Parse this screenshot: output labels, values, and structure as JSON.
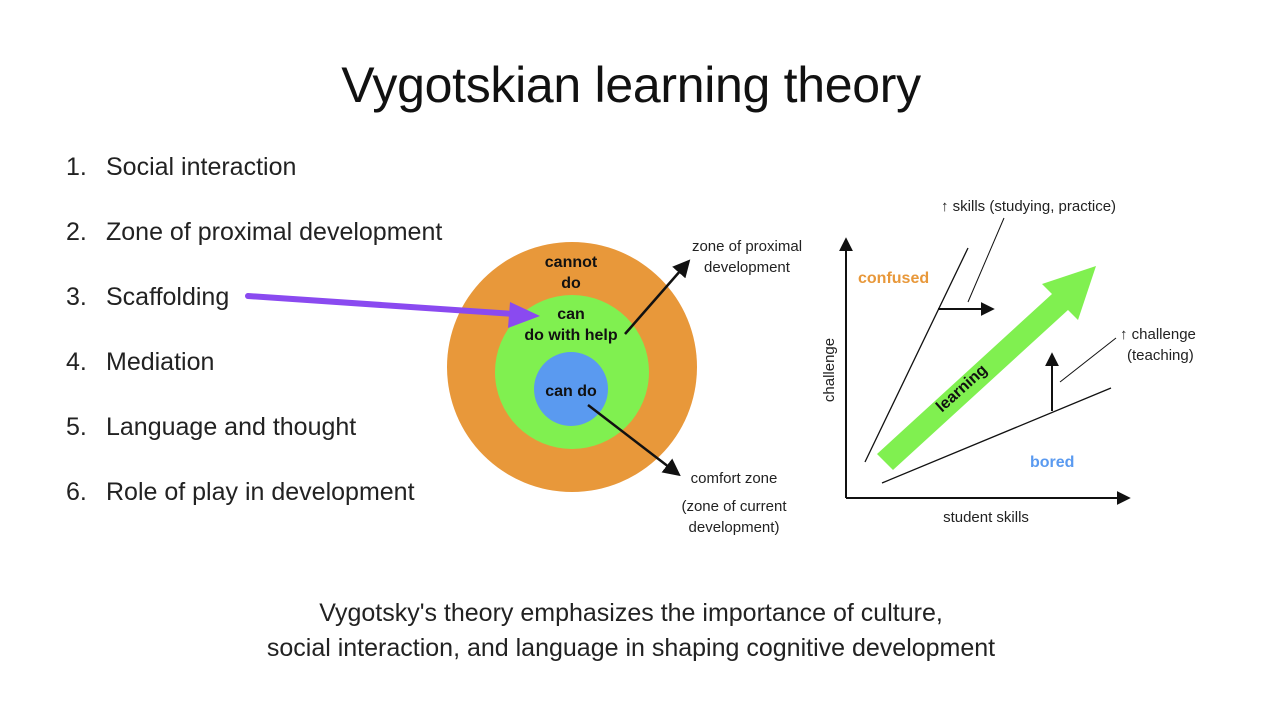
{
  "slide": {
    "title": "Vygotskian learning theory",
    "list": [
      {
        "num": "1.",
        "text": "Social interaction"
      },
      {
        "num": "2.",
        "text": "Zone of proximal development"
      },
      {
        "num": "3.",
        "text": "Scaffolding"
      },
      {
        "num": "4.",
        "text": "Mediation"
      },
      {
        "num": "5.",
        "text": "Language and thought"
      },
      {
        "num": "6.",
        "text": "Role of play in development"
      }
    ],
    "caption": {
      "line1": "Vygotsky's theory emphasizes the importance of culture,",
      "line2": "social interaction, and language in shaping cognitive development"
    }
  },
  "zones": {
    "outer_line1": "cannot",
    "outer_line2": "do",
    "middle_line1": "can",
    "middle_line2": "do with help",
    "inner": "can do",
    "zpd_line1": "zone of proximal",
    "zpd_line2": "development",
    "comfort": "comfort zone",
    "current_line1": "(zone of current",
    "current_line2": "development)"
  },
  "flow": {
    "skills_label": "↑ skills (studying, practice)",
    "challenge_line1": "↑ challenge",
    "challenge_line2": "(teaching)",
    "confused": "confused",
    "bored": "bored",
    "learning": "learning",
    "ylabel": "challenge",
    "xlabel": "student skills"
  },
  "colors": {
    "outer": "#e8983a",
    "middle": "#80f050",
    "inner": "#5a9af0",
    "confused": "#e8983a",
    "bored": "#5a9af0",
    "arrow_purple": "#8a4af0",
    "arrow_green": "#80f050"
  }
}
